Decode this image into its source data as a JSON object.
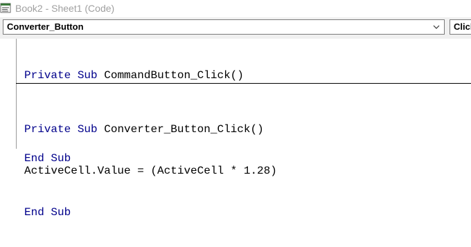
{
  "window": {
    "title": "Book2 - Sheet1 (Code)",
    "icon": "vba-module-icon"
  },
  "toolbar": {
    "object_combo": "Converter_Button",
    "procedure_combo": "Click"
  },
  "code": {
    "block1": {
      "line1": {
        "kw1": "Private",
        "kw2": "Sub",
        "name": "CommandButton_Click()"
      },
      "line2": {
        "kw1": "End",
        "kw2": "Sub"
      }
    },
    "block2": {
      "line1": {
        "kw1": "Private",
        "kw2": "Sub",
        "name": "Converter_Button_Click()"
      },
      "line2": "ActiveCell.Value = (ActiveCell * 1.28)",
      "line3": {
        "kw1": "End",
        "kw2": "Sub"
      }
    }
  },
  "colors": {
    "keyword": "#00008b",
    "text": "#000000",
    "title_text": "#a0a0a0",
    "toolbar_bg": "#f0f0f0"
  }
}
